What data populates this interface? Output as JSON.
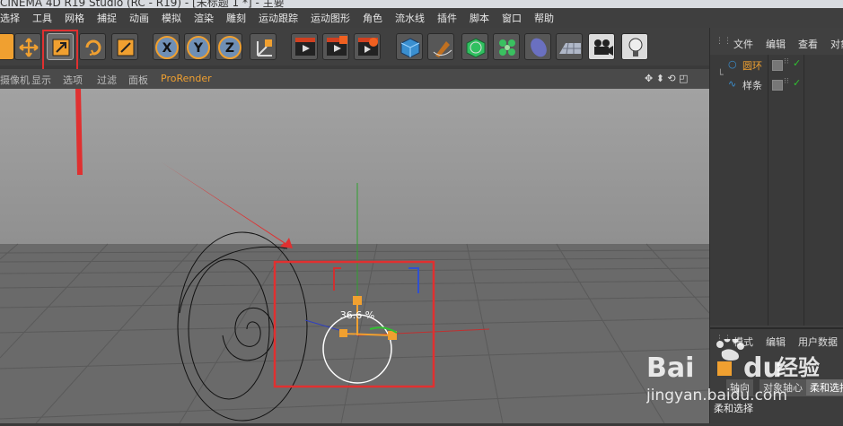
{
  "titlebar": {
    "text": "CINEMA 4D R19 Studio (RC - R19) - [未标题 1 *] - 主要"
  },
  "menu": [
    "选择",
    "工具",
    "网格",
    "捕捉",
    "动画",
    "模拟",
    "渲染",
    "雕刻",
    "运动跟踪",
    "运动图形",
    "角色",
    "流水线",
    "插件",
    "脚本",
    "窗口",
    "帮助"
  ],
  "toolbar": {
    "icons": [
      "undo-icon",
      "move-icon",
      "scale-icon",
      "rotate-icon",
      "live-select-icon",
      "x-axis-icon",
      "y-axis-icon",
      "z-axis-icon",
      "world-coordinates-icon",
      "render-view-icon",
      "render-to-picture-viewer-icon",
      "render-settings-icon",
      "cube-icon",
      "pen-icon",
      "subdivision-icon",
      "cloner-icon",
      "deformer-icon",
      "floor-icon",
      "camera-icon",
      "light-icon"
    ],
    "axis_x": "X",
    "axis_y": "Y",
    "axis_z": "Z"
  },
  "viewport_menu": {
    "items": [
      "摄像机",
      "显示",
      "选项",
      "过滤",
      "面板",
      "ProRender"
    ],
    "highlight": "ProRender"
  },
  "viewport": {
    "hud_scale": "36.6 %"
  },
  "objects_panel": {
    "tabs": [
      "文件",
      "编辑",
      "查看",
      "对象"
    ],
    "objects": [
      {
        "name": "圆环",
        "color": "#f0a030"
      },
      {
        "name": "样条",
        "color": "#e0e0e0"
      }
    ]
  },
  "attributes_panel": {
    "tabs": [
      "模式",
      "编辑",
      "用户数据"
    ],
    "subtabs": [
      "轴向",
      "对象轴心",
      "柔和选择"
    ],
    "section_label": "柔和选择"
  },
  "watermark": {
    "brand": "Bai",
    "brand2": "du",
    "brand_cn": "经验",
    "url": "jingyan.baidu.com"
  },
  "colors": {
    "accent": "#f0a030",
    "highlight_box": "#e03030",
    "axis_x": "#d03030",
    "axis_y": "#30a030",
    "axis_z": "#3050d0"
  }
}
